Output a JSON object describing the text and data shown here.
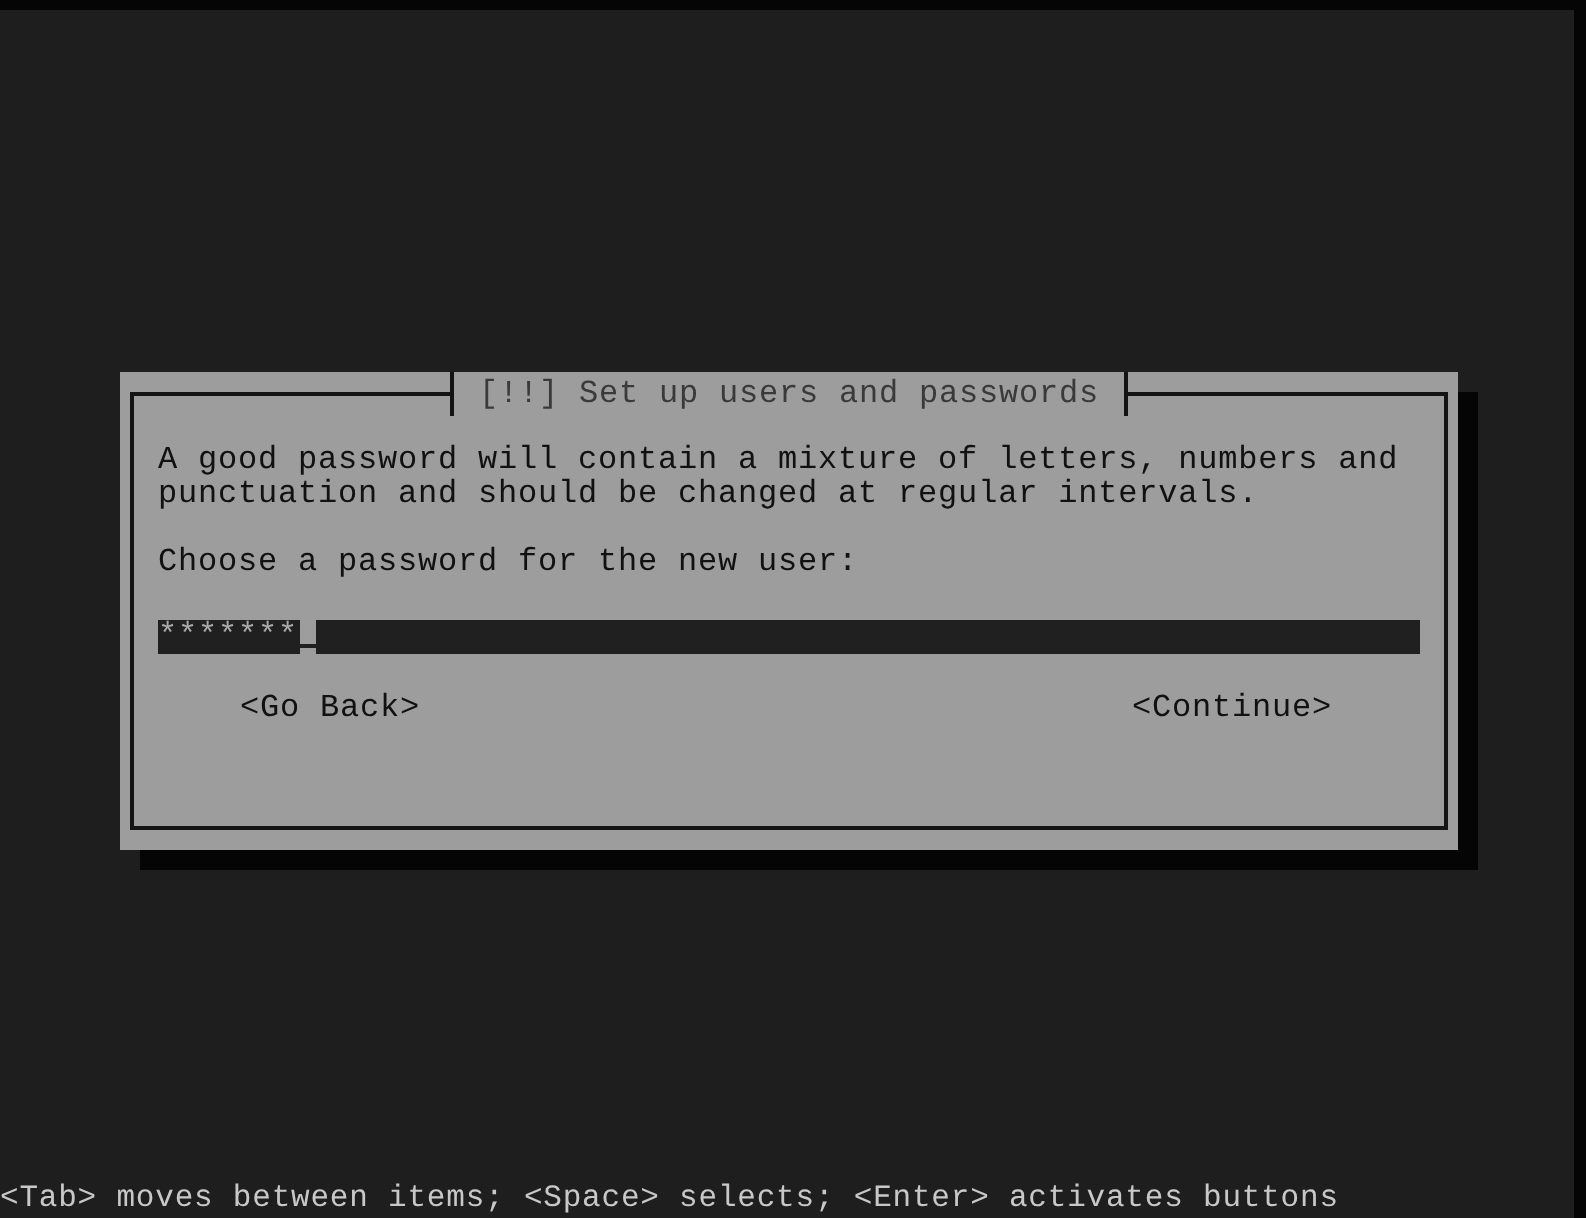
{
  "dialog": {
    "title": "[!!] Set up users and passwords",
    "message": "A good password will contain a mixture of letters, numbers and punctuation and should be changed at regular intervals.",
    "prompt": "Choose a password for the new user:",
    "password_field": {
      "value": "*******"
    },
    "buttons": [
      {
        "label": "<Go Back>",
        "selected": false
      },
      {
        "label": "<Continue>",
        "selected": false
      }
    ]
  },
  "help_line": "<Tab> moves between items; <Space> selects; <Enter> activates buttons"
}
